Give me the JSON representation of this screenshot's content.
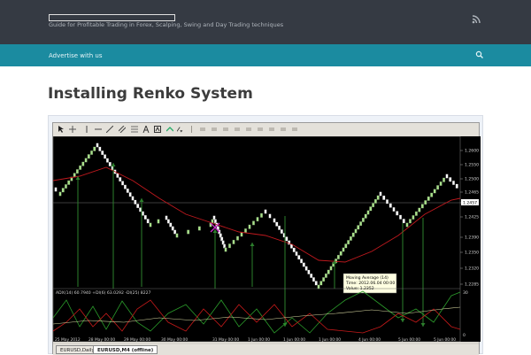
{
  "site": {
    "tagline": "Guide for Profitable Trading in Forex, Scalping, Swing and Day Trading techniques"
  },
  "nav": {
    "advertise": "Advertise with us"
  },
  "article": {
    "title": "Installing Renko System"
  },
  "terminal": {
    "price_labels": [
      "1.2600",
      "1.2550",
      "1.2500",
      "1.2465",
      "1.2457",
      "1.2425",
      "1.2390",
      "1.2350",
      "1.2320",
      "1.2285"
    ],
    "current_price": "1.2457",
    "indicator_header": "ADX(14) 60.7940 +DI(6) 63.0292 -DI(25) 8227",
    "indicator_scale": [
      "30",
      "0"
    ],
    "date_labels": [
      "25 May 2012",
      "28 May 00:00",
      "29 May 00:00",
      "30 May 00:00",
      "31 May 00:00",
      "1 Jun 00:00",
      "4 Jun 00:00",
      "5 Jun 00:00"
    ],
    "tooltip": {
      "name": "Moving Average (14)",
      "time": "Time: 2012.06.04 00:00",
      "value": "Value: 1.2352"
    },
    "tabs": [
      "EURUSD,Daily",
      "EURUSD,M4 (offline)"
    ],
    "colors": {
      "bull_brick": "#a8e08a",
      "bear_brick": "#ffffff",
      "moving_average": "#c0191e",
      "plus_di": "#2b9b2b",
      "minus_di": "#c61a1a",
      "signal": "#2d7f2d",
      "cross": "#cc33cc"
    }
  }
}
